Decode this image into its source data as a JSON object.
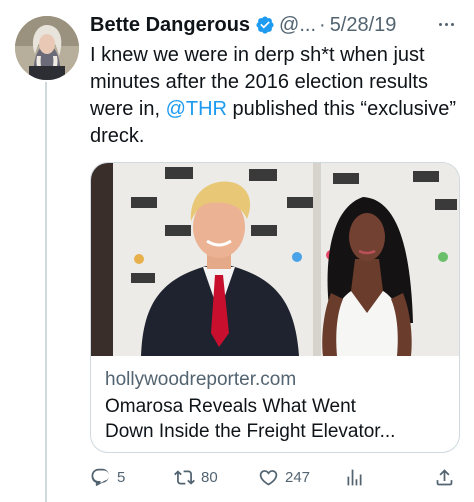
{
  "author": {
    "name": "Bette Dangerous",
    "handle": "@...",
    "separator": "·",
    "date": "5/28/19",
    "verified_color": "#1d9bf0"
  },
  "tweet": {
    "text_before_mention": "I knew we were in derp sh*t when just minutes after the 2016 election results were in, ",
    "mention": "@THR",
    "text_after_mention": " published this “exclusive” dreck."
  },
  "link_card": {
    "domain": "hollywoodreporter.com",
    "title_line1": "Omarosa Reveals What Went",
    "title_line2": "Down Inside the Freight Elevator..."
  },
  "actions": {
    "replies": "5",
    "retweets": "80",
    "likes": "247",
    "icons": [
      "reply-icon",
      "retweet-icon",
      "like-icon",
      "views-icon",
      "share-icon"
    ]
  },
  "colors": {
    "text": "#0f1419",
    "secondary": "#536471",
    "link": "#1d9bf0",
    "border": "#cfd9de"
  }
}
